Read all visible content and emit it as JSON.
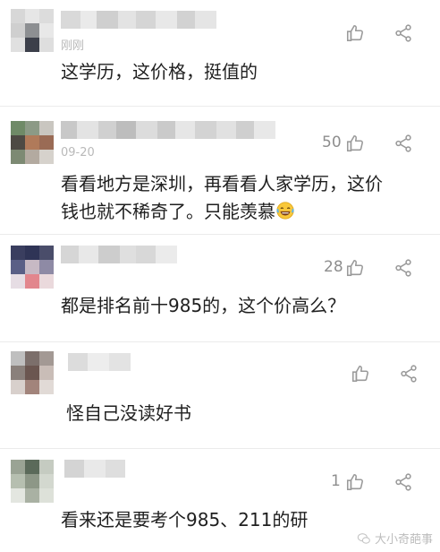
{
  "comments": [
    {
      "text": "这学历，这价格，挺值的",
      "meta": "刚刚",
      "likes": ""
    },
    {
      "text_lines": [
        "看看地方是深圳，再看看人家学历，这价",
        "钱也就不稀奇了。只能羡慕"
      ],
      "meta": "09-20",
      "likes": "50"
    },
    {
      "text": "都是排名前十985的，这个价高么？",
      "meta": "",
      "likes": "28"
    },
    {
      "text": "怪自己没读好书",
      "meta": "",
      "likes": ""
    },
    {
      "text": "看来还是要考个985、211的研",
      "meta": "",
      "likes": "1"
    }
  ],
  "icons": {
    "like": "thumbs-up-icon",
    "share": "share-icon",
    "emoji": "laughing-tears-emoji"
  },
  "watermark": {
    "text": "大小奇葩事"
  },
  "colors": {
    "text": "#1f1f1f",
    "meta": "#b9b9b9",
    "icon": "#9a9a9a"
  }
}
